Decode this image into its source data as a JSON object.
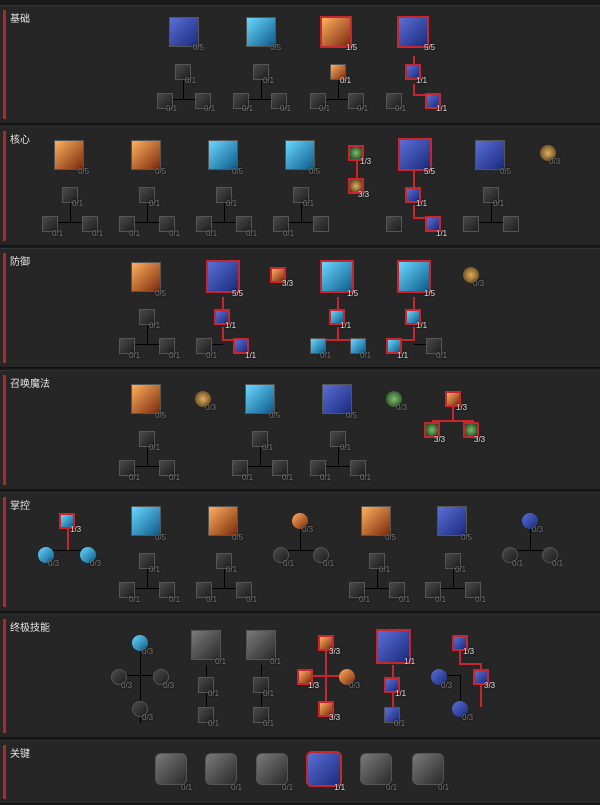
{
  "sections": {
    "basic": {
      "label": "基础",
      "nodes": [
        "0/5",
        "0/5",
        "1/5",
        "5/5",
        "0/1",
        "0/1",
        "0/1",
        "1/1",
        "0/1",
        "0/1",
        "0/1",
        "0/1",
        "0/1",
        "0/1",
        "0/1",
        "1/1"
      ]
    },
    "core": {
      "label": "核心",
      "nodes": [
        "0/5",
        "0/5",
        "0/5",
        "0/5",
        "1/3",
        "3/3",
        "5/5",
        "0/5",
        "0/3",
        "1/1",
        "1/1",
        "0/1",
        "0/1",
        "0/1",
        "0/1",
        "0/1",
        "0/1",
        "0/1",
        "0/1",
        "0/1",
        "0/1",
        "0/1",
        "0/1"
      ]
    },
    "defense": {
      "label": "防御",
      "nodes": [
        "0/5",
        "5/5",
        "3/3",
        "1/5",
        "1/5",
        "0/3",
        "0/1",
        "1/1",
        "1/1",
        "1/1",
        "0/1",
        "0/1",
        "0/1",
        "1/1",
        "0/1",
        "0/1",
        "1/1",
        "0/1"
      ]
    },
    "conjuration": {
      "label": "召唤魔法",
      "nodes": [
        "0/5",
        "0/3",
        "0/5",
        "0/5",
        "0/3",
        "1/3",
        "3/3",
        "3/3",
        "0/1",
        "0/1",
        "0/1",
        "0/1",
        "0/1",
        "0/1",
        "0/1",
        "0/1",
        "0/1"
      ]
    },
    "mastery": {
      "label": "掌控",
      "nodes": [
        "1/3",
        "0/3",
        "0/3",
        "0/5",
        "0/3",
        "0/5",
        "0/5",
        "0/5",
        "0/3",
        "0/1",
        "0/1",
        "0/1",
        "0/1",
        "0/1",
        "0/1",
        "0/1",
        "0/1",
        "0/1",
        "0/1",
        "0/1",
        "0/1",
        "0/1",
        "0/1",
        "0/1",
        "0/1",
        "0/1",
        "0/1",
        "0/1",
        "0/1"
      ]
    },
    "ultimate": {
      "label": "终极技能",
      "nodes": [
        "0/3",
        "0/3",
        "0/3",
        "0/3",
        "0/1",
        "0/1",
        "0/1",
        "0/1",
        "0/1",
        "0/1",
        "3/3",
        "1/3",
        "0/3",
        "3/3",
        "1/1",
        "1/1",
        "0/1",
        "1/3",
        "0/3",
        "3/3",
        "0/3"
      ]
    },
    "key": {
      "label": "关键",
      "nodes": [
        "0/1",
        "0/1",
        "0/1",
        "1/1",
        "0/1",
        "0/1"
      ]
    }
  },
  "colors": {
    "highlight": "#c8262e",
    "rail": "#b3262a",
    "panel": "#262626",
    "background": "#1a1a1a"
  }
}
